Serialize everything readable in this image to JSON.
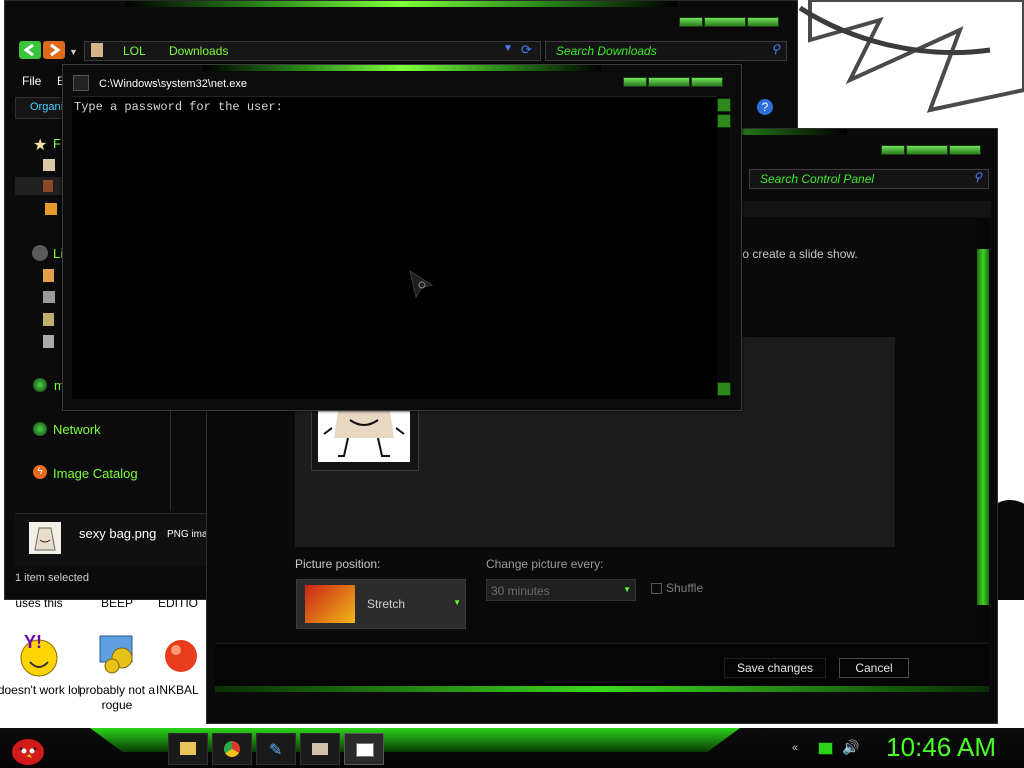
{
  "explorer": {
    "breadcrumb": [
      "LOL",
      "Downloads"
    ],
    "search_placeholder": "Search Downloads",
    "menu": [
      "File",
      "E"
    ],
    "organize_label": "Organi",
    "sidebar": {
      "favorites_prefix": "F",
      "libraries_prefix": "Li",
      "homegroup_prefix": "m",
      "network": "Network",
      "image_catalog": "Image Catalog"
    },
    "preview": {
      "filename": "sexy bag.png",
      "filetype": "PNG ima"
    },
    "status": "1 item selected"
  },
  "cmd": {
    "title": "C:\\Windows\\system32\\net.exe",
    "output": "Type a password for the user:"
  },
  "control_panel": {
    "search_placeholder": "Search Control Panel",
    "hint": "to create a slide show.",
    "picture_position_label": "Picture position:",
    "picture_position_value": "Stretch",
    "change_every_label": "Change picture every:",
    "change_every_value": "30 minutes",
    "shuffle_label": "Shuffle",
    "save_button": "Save changes",
    "cancel_button": "Cancel"
  },
  "desktop_icons": [
    {
      "label": "uses this"
    },
    {
      "label": "BEEP"
    },
    {
      "label": "EDITIO"
    },
    {
      "label": "doesn't work lol"
    },
    {
      "label": "probably not a rogue"
    },
    {
      "label": "INKBAL"
    }
  ],
  "taskbar": {
    "clock": "10:46 AM",
    "pinned": [
      "explorer-icon",
      "chrome-icon",
      "tool-icon",
      "mail-icon",
      "window-icon"
    ]
  },
  "colors": {
    "accent": "#62ff2a",
    "window_bg": "#0b0b0b"
  }
}
